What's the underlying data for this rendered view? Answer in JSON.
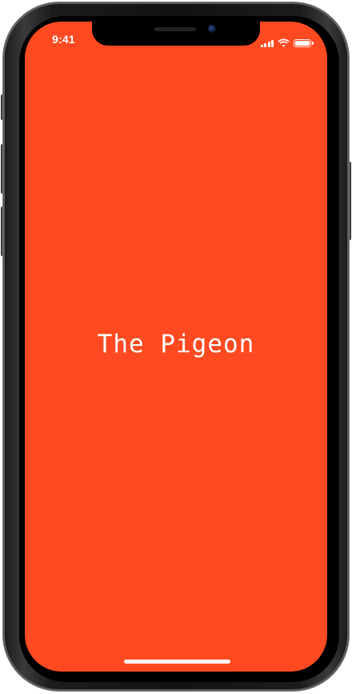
{
  "status_bar": {
    "time": "9:41",
    "signal_icon": "cellular-signal-icon",
    "wifi_icon": "wifi-icon",
    "battery_icon": "battery-icon",
    "battery_level": 1.0
  },
  "splash": {
    "title": "The Pigeon",
    "background_color": "#ff4a21",
    "text_color": "#ffffff"
  },
  "home_indicator": {
    "icon": "home-indicator-bar"
  }
}
